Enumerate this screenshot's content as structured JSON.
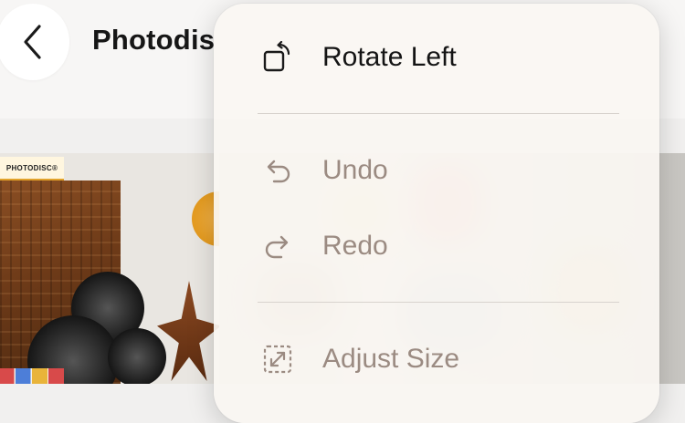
{
  "header": {
    "title": "Photodis",
    "back_icon": "chevron-left-icon"
  },
  "photo": {
    "badge": "PHOTODISC®"
  },
  "context_menu": {
    "items": [
      {
        "label": "Rotate Left",
        "icon": "rotate-left-icon",
        "state": "enabled"
      },
      {
        "label": "Undo",
        "icon": "undo-icon",
        "state": "disabled"
      },
      {
        "label": "Redo",
        "icon": "redo-icon",
        "state": "disabled"
      },
      {
        "label": "Adjust Size",
        "icon": "adjust-size-icon",
        "state": "disabled"
      }
    ]
  },
  "colors": {
    "menu_background": "#faf6f2",
    "enabled_text": "#141414",
    "disabled_text": "#9b8b82",
    "divider": "#d8d3ce"
  }
}
